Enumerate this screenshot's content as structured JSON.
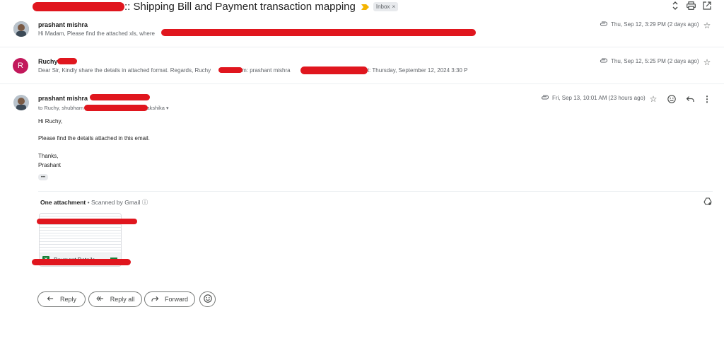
{
  "thread": {
    "subject": ":: Shipping Bill and Payment transaction mapping",
    "label_chip": "Inbox"
  },
  "messages": [
    {
      "sender": "prashant mishra",
      "snippet": "Hi Madam, Please find the attached xls, where",
      "date": "Thu, Sep 12, 3:29 PM (2 days ago)"
    },
    {
      "sender": "Ruchy",
      "avatar_letter": "R",
      "snippet_prefix": "Dear Sir, Kindly share the details in attached format. Regards, Ruchy",
      "snippet_from": "From: prashant mishra",
      "snippet_sent": "Sent: Thursday, September 12, 2024 3:30 P",
      "date": "Thu, Sep 12, 5:25 PM (2 days ago)"
    },
    {
      "sender": "prashant mishra",
      "to_prefix": "to Ruchy, shubham",
      "to_suffix": "Rakshika",
      "date": "Fri, Sep 13, 10:01 AM (23 hours ago)",
      "body": {
        "greeting": "Hi Ruchy,",
        "line1": "Please find the details attached in this email.",
        "thanks": "Thanks,",
        "signature": "Prashant",
        "more": "•••"
      }
    }
  ],
  "attachments": {
    "title": "One attachment",
    "scanned": "Scanned by Gmail",
    "file_name": "Payment Details"
  },
  "actions": {
    "reply": "Reply",
    "reply_all": "Reply all",
    "forward": "Forward"
  },
  "colors": {
    "accent_avatar": "#c2185b",
    "redaction": "#e0161e",
    "label_arrow": "#f4b400",
    "excel_green": "#188038"
  }
}
